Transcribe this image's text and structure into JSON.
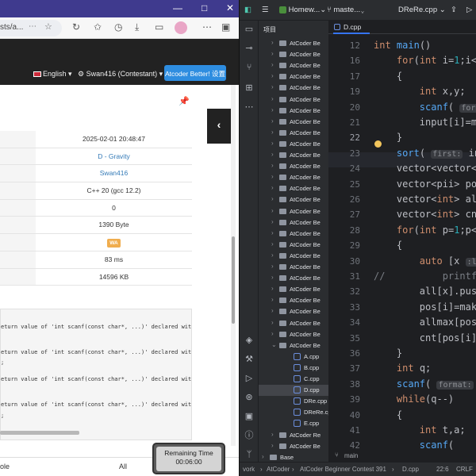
{
  "browser": {
    "url_fragment": "sts/a...",
    "nav": {
      "language": "English",
      "user": "Swan416 (Contestant)",
      "better_button": "Atcoder Better! 设置"
    },
    "submission_info": [
      {
        "value": "2025-02-01 20:48:47",
        "link": false
      },
      {
        "value": "D - Gravity",
        "link": true
      },
      {
        "value": "Swan416",
        "link": true
      },
      {
        "value": "C++ 20 (gcc 12.2)",
        "link": false
      },
      {
        "value": "0",
        "link": false
      },
      {
        "value": "1390 Byte",
        "link": false
      },
      {
        "value": "WA",
        "badge": true
      },
      {
        "value": "83 ms",
        "link": false
      },
      {
        "value": "14596 KB",
        "link": false
      }
    ],
    "compile_lines": [
      "eturn value of 'int scanf(const char*, ...)' declared wit",
      "eturn value of 'int scanf(const char*, ...)' declared wit",
      ";",
      "eturn value of 'int scanf(const char*, ...)' declared wit",
      "eturn value of 'int scanf(const char*, ...)' declared wit",
      ";"
    ],
    "bottom_left": "ole",
    "bottom_all": "All",
    "timer": {
      "label": "Remaining Time",
      "value": "00:06:00"
    }
  },
  "ide": {
    "top": {
      "project": "Homew...",
      "branch": "maste...",
      "run_config": "DReRe.cpp"
    },
    "tree_header": "项目",
    "tree_items": [
      {
        "name": "AtCoder Be",
        "type": "folder",
        "expanded": false
      },
      {
        "name": "AtCoder Be",
        "type": "folder",
        "expanded": false
      },
      {
        "name": "AtCoder Be",
        "type": "folder",
        "expanded": false
      },
      {
        "name": "AtCoder Be",
        "type": "folder",
        "expanded": false
      },
      {
        "name": "AtCoder Be",
        "type": "folder",
        "expanded": false
      },
      {
        "name": "AtCoder Be",
        "type": "folder",
        "expanded": false
      },
      {
        "name": "AtCoder Be",
        "type": "folder",
        "expanded": false
      },
      {
        "name": "AtCoder Be",
        "type": "folder",
        "expanded": false
      },
      {
        "name": "AtCoder Be",
        "type": "folder",
        "expanded": false
      },
      {
        "name": "AtCoder Be",
        "type": "folder",
        "expanded": false
      },
      {
        "name": "AtCoder Be",
        "type": "folder",
        "expanded": false
      },
      {
        "name": "AtCoder Be",
        "type": "folder",
        "expanded": false
      },
      {
        "name": "AtCoder Be",
        "type": "folder",
        "expanded": false
      },
      {
        "name": "AtCoder Be",
        "type": "folder",
        "expanded": false
      },
      {
        "name": "AtCoder Be",
        "type": "folder",
        "expanded": false
      },
      {
        "name": "AtCoder Be",
        "type": "folder",
        "expanded": false
      },
      {
        "name": "AtCoder Be",
        "type": "folder",
        "expanded": false
      },
      {
        "name": "AtCoder Be",
        "type": "folder",
        "expanded": false
      },
      {
        "name": "AtCoder Be",
        "type": "folder",
        "expanded": false
      },
      {
        "name": "AtCoder Be",
        "type": "folder",
        "expanded": false
      },
      {
        "name": "AtCoder Be",
        "type": "folder",
        "expanded": false
      },
      {
        "name": "AtCoder Be",
        "type": "folder",
        "expanded": false
      },
      {
        "name": "AtCoder Be",
        "type": "folder",
        "expanded": false
      },
      {
        "name": "AtCoder Be",
        "type": "folder",
        "expanded": false
      },
      {
        "name": "AtCoder Be",
        "type": "folder",
        "expanded": false
      },
      {
        "name": "AtCoder Be",
        "type": "folder",
        "expanded": false
      },
      {
        "name": "AtCoder Be",
        "type": "folder",
        "expanded": false
      },
      {
        "name": "AtCoder Be",
        "type": "folder",
        "expanded": true
      },
      {
        "name": "A.cpp",
        "type": "file"
      },
      {
        "name": "B.cpp",
        "type": "file"
      },
      {
        "name": "C.cpp",
        "type": "file"
      },
      {
        "name": "D.cpp",
        "type": "file",
        "selected": true
      },
      {
        "name": "DRe.cpp",
        "type": "file"
      },
      {
        "name": "DReRe.cpp",
        "type": "file"
      },
      {
        "name": "E.cpp",
        "type": "file"
      },
      {
        "name": "AtCoder Re",
        "type": "folder",
        "expanded": false
      },
      {
        "name": "AtCoder Be",
        "type": "folder",
        "expanded": false
      },
      {
        "name": "Base",
        "type": "folder",
        "expanded": false,
        "top": true
      },
      {
        "name": "CodeChef",
        "type": "folder",
        "expanded": false,
        "top": true
      },
      {
        "name": "Codeforces",
        "type": "folder",
        "expanded": false,
        "top": true
      }
    ],
    "editor_tab": "D.cpp",
    "code_lines": [
      {
        "ln": "12",
        "html": "<span class=\"kw\">int</span> <span class=\"fn\">main</span>()"
      },
      {
        "ln": "16",
        "html": "    <span class=\"kw\">for</span>(<span class=\"kw\">int</span> i=<span class=\"num\">1</span>;i&lt;="
      },
      {
        "ln": "17",
        "html": "    {"
      },
      {
        "ln": "19",
        "html": "        <span class=\"kw\">int</span> x,y;"
      },
      {
        "ln": "20",
        "html": "        <span class=\"fn\">scanf</span>( <span class=\"hint\">format:</span>"
      },
      {
        "ln": "21",
        "html": "        input[i]=ma"
      },
      {
        "ln": "22",
        "html": "    }"
      },
      {
        "ln": "23",
        "html": "    <span class=\"fn\">sort</span>( <span class=\"hint\">first:</span> input"
      },
      {
        "ln": "24",
        "html": "    vector&lt;vector&lt;i"
      },
      {
        "ln": "25",
        "html": "    vector&lt;pii&gt; pos"
      },
      {
        "ln": "26",
        "html": "    vector&lt;<span class=\"kw\">int</span>&gt; al"
      },
      {
        "ln": "27",
        "html": "    vector&lt;<span class=\"kw\">int</span>&gt; cnt"
      },
      {
        "ln": "28",
        "html": "    <span class=\"kw\">for</span>(<span class=\"kw\">int</span> p=<span class=\"num\">1</span>;p&lt;="
      },
      {
        "ln": "29",
        "html": "    {"
      },
      {
        "ln": "30",
        "html": "        <span class=\"kw\">auto</span> [x <span class=\"hint\">:lo</span>"
      },
      {
        "ln": "31",
        "html": "<span class=\"cm\">//          printf(\"%</span>"
      },
      {
        "ln": "32",
        "html": "        all[x].push"
      },
      {
        "ln": "33",
        "html": "        pos[i]=make"
      },
      {
        "ln": "34",
        "html": "        allmax[pos"
      },
      {
        "ln": "35",
        "html": "        cnt[pos[i]"
      },
      {
        "ln": "36",
        "html": "    }"
      },
      {
        "ln": "37",
        "html": "    <span class=\"kw\">int</span> q;"
      },
      {
        "ln": "38",
        "html": "    <span class=\"fn\">scanf</span>( <span class=\"hint\">format:</span> <span class=\"num\">\"%</span>"
      },
      {
        "ln": "39",
        "html": "    <span class=\"kw\">while</span>(q--)"
      },
      {
        "ln": "40",
        "html": "    {"
      },
      {
        "ln": "41",
        "html": "        <span class=\"kw\">int</span> t,a;"
      },
      {
        "ln": "42",
        "html": "        <span class=\"fn\">scanf</span>("
      }
    ],
    "branch_label": "main",
    "status": {
      "path1": "vork",
      "path2": "AtCoder",
      "path3": "AtCoder Beginner Contest 391",
      "path4": "D.cpp",
      "position": "22:6",
      "line_sep": "CRLF"
    }
  }
}
